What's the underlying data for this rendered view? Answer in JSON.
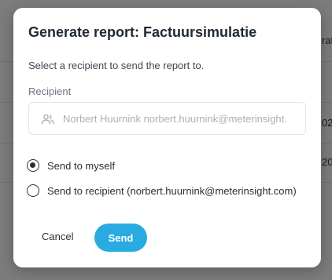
{
  "background": {
    "column_header_fragment": "rat",
    "row_fragments": [
      "02",
      "20"
    ]
  },
  "modal": {
    "title": "Generate report: Factuursimulatie",
    "description": "Select a recipient to send the report to.",
    "recipient": {
      "label": "Recipient",
      "value": "Norbert Huurnink norbert.huurnink@meterinsight.",
      "icon": "users-icon"
    },
    "options": [
      {
        "label": "Send to myself",
        "checked": true
      },
      {
        "label": "Send to recipient (norbert.huurnink@meterinsight.com)",
        "checked": false
      }
    ],
    "cancel_label": "Cancel",
    "send_label": "Send"
  },
  "colors": {
    "accent": "#29abe2",
    "overlay": "#7b7b7b",
    "modal_bg": "#ffffff"
  }
}
